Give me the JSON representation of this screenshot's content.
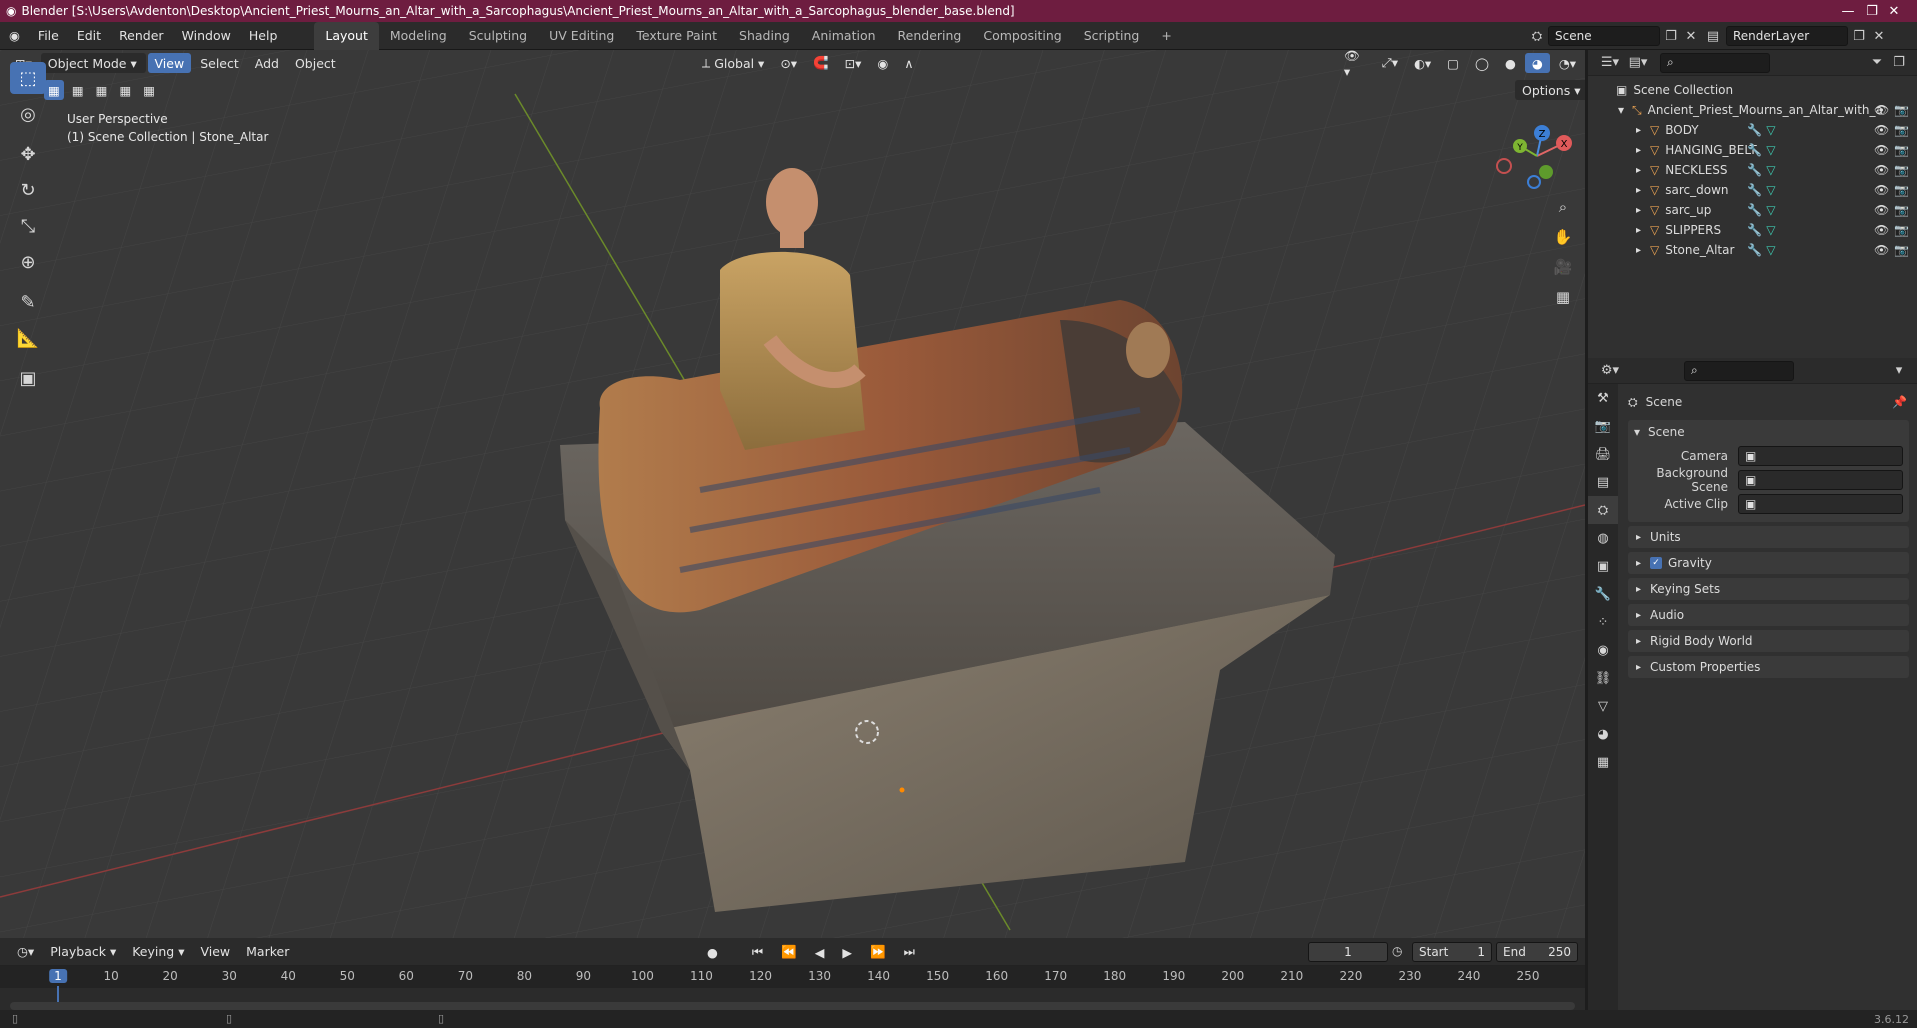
{
  "window": {
    "title": "Blender [S:\\Users\\Avdenton\\Desktop\\Ancient_Priest_Mourns_an_Altar_with_a_Sarcophagus\\Ancient_Priest_Mourns_an_Altar_with_a_Sarcophagus_blender_base.blend]",
    "controls": [
      "—",
      "❐",
      "✕"
    ]
  },
  "menu": [
    "File",
    "Edit",
    "Render",
    "Window",
    "Help"
  ],
  "workspaces": [
    {
      "label": "Layout",
      "active": true
    },
    {
      "label": "Modeling",
      "active": false
    },
    {
      "label": "Sculpting",
      "active": false
    },
    {
      "label": "UV Editing",
      "active": false
    },
    {
      "label": "Texture Paint",
      "active": false
    },
    {
      "label": "Shading",
      "active": false
    },
    {
      "label": "Animation",
      "active": false
    },
    {
      "label": "Rendering",
      "active": false
    },
    {
      "label": "Compositing",
      "active": false
    },
    {
      "label": "Scripting",
      "active": false
    }
  ],
  "scene_field": "Scene",
  "renderlayer_field": "RenderLayer",
  "viewport": {
    "mode": "Object Mode",
    "menu": [
      "View",
      "Select",
      "Add",
      "Object"
    ],
    "transform_orientation": "Global",
    "options": "Options",
    "overlay_title": "User Perspective",
    "overlay_sub": "(1) Scene Collection | Stone_Altar",
    "gizmo": {
      "x": "X",
      "y": "Y",
      "z": "Z"
    }
  },
  "tools": [
    {
      "name": "select-box-tool",
      "glyph": "⬚",
      "active": true
    },
    {
      "name": "cursor-tool",
      "glyph": "◎",
      "active": false
    },
    {
      "name": "move-tool",
      "glyph": "✥",
      "active": false
    },
    {
      "name": "rotate-tool",
      "glyph": "↻",
      "active": false
    },
    {
      "name": "scale-tool",
      "glyph": "⤡",
      "active": false
    },
    {
      "name": "transform-tool",
      "glyph": "⊕",
      "active": false
    },
    {
      "name": "annotate-tool",
      "glyph": "✎",
      "active": false
    },
    {
      "name": "measure-tool",
      "glyph": "📐",
      "active": false
    },
    {
      "name": "add-cube-tool",
      "glyph": "▣",
      "active": false
    }
  ],
  "outliner": {
    "root": "Scene Collection",
    "collection": "Ancient_Priest_Mourns_an_Altar_with_a",
    "objects": [
      "BODY",
      "HANGING_BELT",
      "NECKLESS",
      "sarc_down",
      "sarc_up",
      "SLIPPERS",
      "Stone_Altar"
    ]
  },
  "properties": {
    "context": "Scene",
    "panel": "Scene",
    "fields": [
      {
        "label": "Camera",
        "value": ""
      },
      {
        "label": "Background Scene",
        "value": ""
      },
      {
        "label": "Active Clip",
        "value": ""
      }
    ],
    "sections": [
      {
        "label": "Units",
        "checkbox": false
      },
      {
        "label": "Gravity",
        "checkbox": true
      },
      {
        "label": "Keying Sets",
        "checkbox": false
      },
      {
        "label": "Audio",
        "checkbox": false
      },
      {
        "label": "Rigid Body World",
        "checkbox": false
      },
      {
        "label": "Custom Properties",
        "checkbox": false
      }
    ]
  },
  "timeline": {
    "menu": [
      "Playback",
      "Keying",
      "View",
      "Marker"
    ],
    "current_frame": "1",
    "start_label": "Start",
    "start": "1",
    "end_label": "End",
    "end": "250",
    "ticks": [
      "1",
      "10",
      "20",
      "30",
      "40",
      "50",
      "60",
      "70",
      "80",
      "90",
      "100",
      "110",
      "120",
      "130",
      "140",
      "150",
      "160",
      "170",
      "180",
      "190",
      "200",
      "210",
      "220",
      "230",
      "240",
      "250"
    ]
  },
  "version": "3.6.12"
}
